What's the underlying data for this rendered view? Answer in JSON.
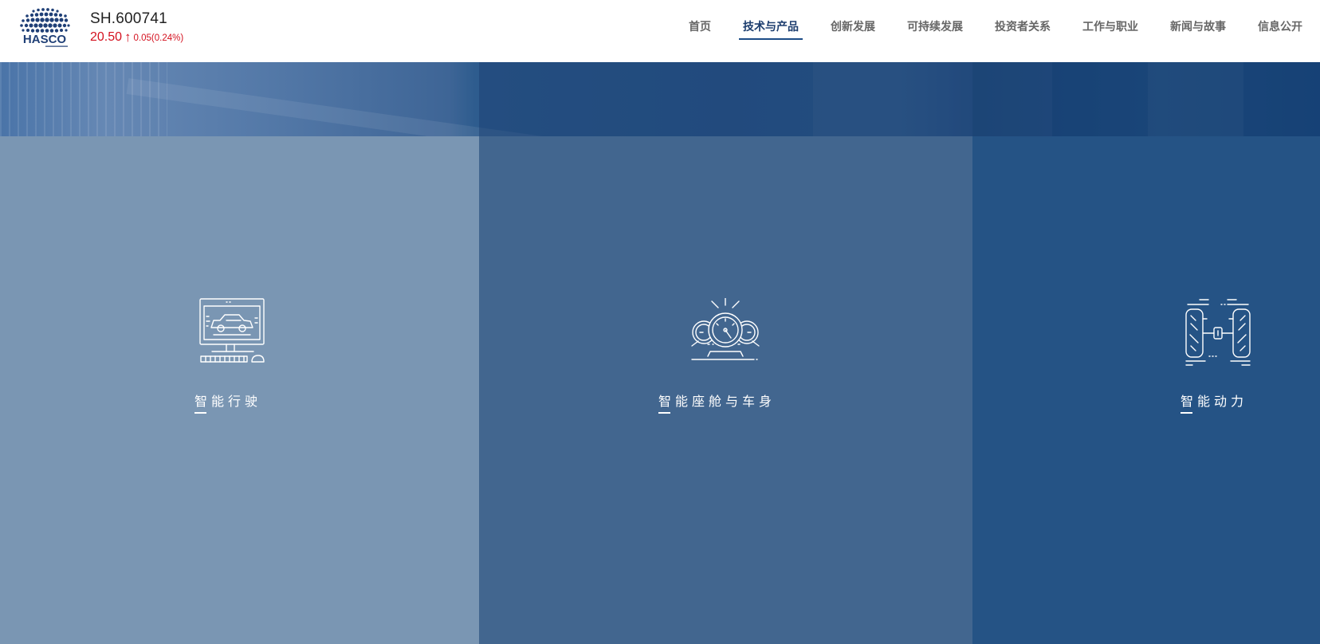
{
  "header": {
    "logo_text": "HASCO",
    "stock": {
      "code": "SH.600741",
      "price": "20.50",
      "arrow": "↑",
      "change": "0.05(0.24%)",
      "color": "#d4101e"
    },
    "nav": [
      {
        "label": "首页",
        "active": false
      },
      {
        "label": "技术与产品",
        "active": true
      },
      {
        "label": "创新发展",
        "active": false
      },
      {
        "label": "可持续发展",
        "active": false
      },
      {
        "label": "投资者关系",
        "active": false
      },
      {
        "label": "工作与职业",
        "active": false
      },
      {
        "label": "新闻与故事",
        "active": false
      },
      {
        "label": "信息公开",
        "active": false
      }
    ],
    "active_color": "#1c4c87"
  },
  "cards": [
    {
      "label": "智能行驶",
      "icon": "monitor-car-icon"
    },
    {
      "label": "智能座舱与车身",
      "icon": "dashboard-gauges-icon"
    },
    {
      "label": "智能动力",
      "icon": "chassis-axle-icon"
    }
  ],
  "colors": {
    "panel_1": "#7a96b3",
    "panel_2": "#42668f",
    "panel_3": "#255385"
  }
}
